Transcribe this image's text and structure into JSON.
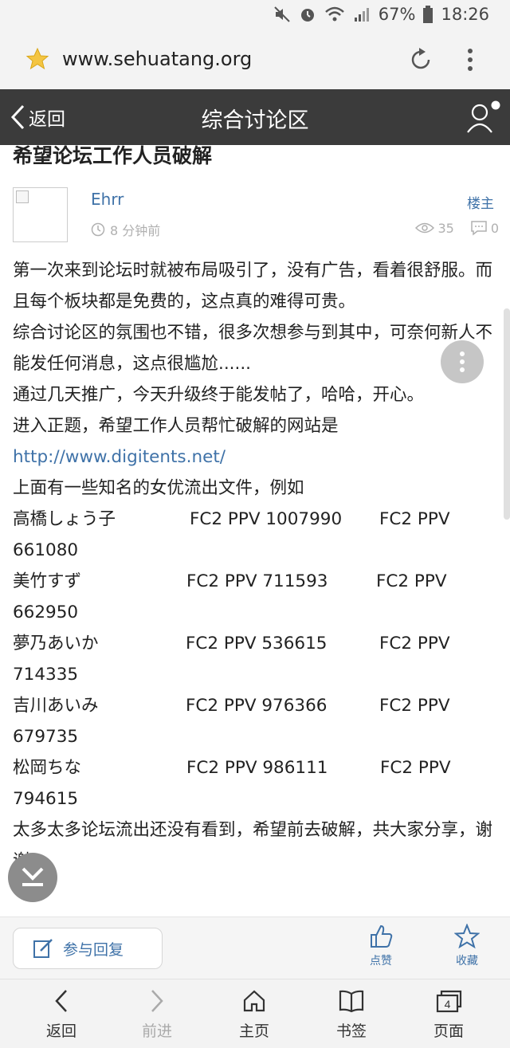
{
  "status_bar": {
    "battery": "67%",
    "time": "18:26",
    "icons": [
      "mute-icon",
      "alarm-icon",
      "wifi-icon",
      "signal-icon",
      "battery-icon"
    ]
  },
  "browser": {
    "url": "www.sehuatang.org"
  },
  "header": {
    "back_label": "返回",
    "title": "综合讨论区"
  },
  "post": {
    "title": "希望论坛工作人员破解",
    "author": "Ehrr",
    "time": "8 分钟前",
    "op_badge": "楼主",
    "views": "35",
    "replies": "0",
    "paragraphs": [
      "第一次来到论坛时就被布局吸引了，没有广告，看着很舒服。而且每个板块都是免费的，这点真的难得可贵。",
      "综合讨论区的氛围也不错，很多次想参与到其中，可奈何新人不能发任何消息，这点很尴尬......",
      "通过几天推广，今天升级终于能发帖了，哈哈，开心。",
      "进入正题，希望工作人员帮忙破解的网站是"
    ],
    "link": "http://www.digitents.net/",
    "intro_line": "上面有一些知名的女优流出文件，例如",
    "entries": [
      {
        "name": "高橋しょう子",
        "code1": "FC2 PPV 1007990",
        "code2": "FC2 PPV",
        "code2_num": "661080"
      },
      {
        "name": "美竹すず",
        "code1": "FC2 PPV 711593",
        "code2": "FC2 PPV",
        "code2_num": "662950"
      },
      {
        "name": "夢乃あいか",
        "code1": "FC2 PPV 536615",
        "code2": "FC2 PPV",
        "code2_num": "714335"
      },
      {
        "name": "吉川あいみ",
        "code1": "FC2 PPV 976366",
        "code2": "FC2 PPV",
        "code2_num": "679735"
      },
      {
        "name": "松岡ちな",
        "code1": "FC2 PPV 986111",
        "code2": "FC2 PPV",
        "code2_num": "794615"
      }
    ],
    "closing": "太多太多论坛流出还没有看到，希望前去破解，共大家分享，谢谢。"
  },
  "actions": {
    "reply_label": "参与回复",
    "like_label": "点赞",
    "favorite_label": "收藏"
  },
  "bottom_nav": {
    "back": "返回",
    "forward": "前进",
    "home": "主页",
    "bookmarks": "书签",
    "tabs": "页面",
    "tab_count": "4"
  },
  "colors": {
    "nav_bg": "#3b3b3b",
    "link": "#3f72a8",
    "muted": "#b0b0b0"
  }
}
